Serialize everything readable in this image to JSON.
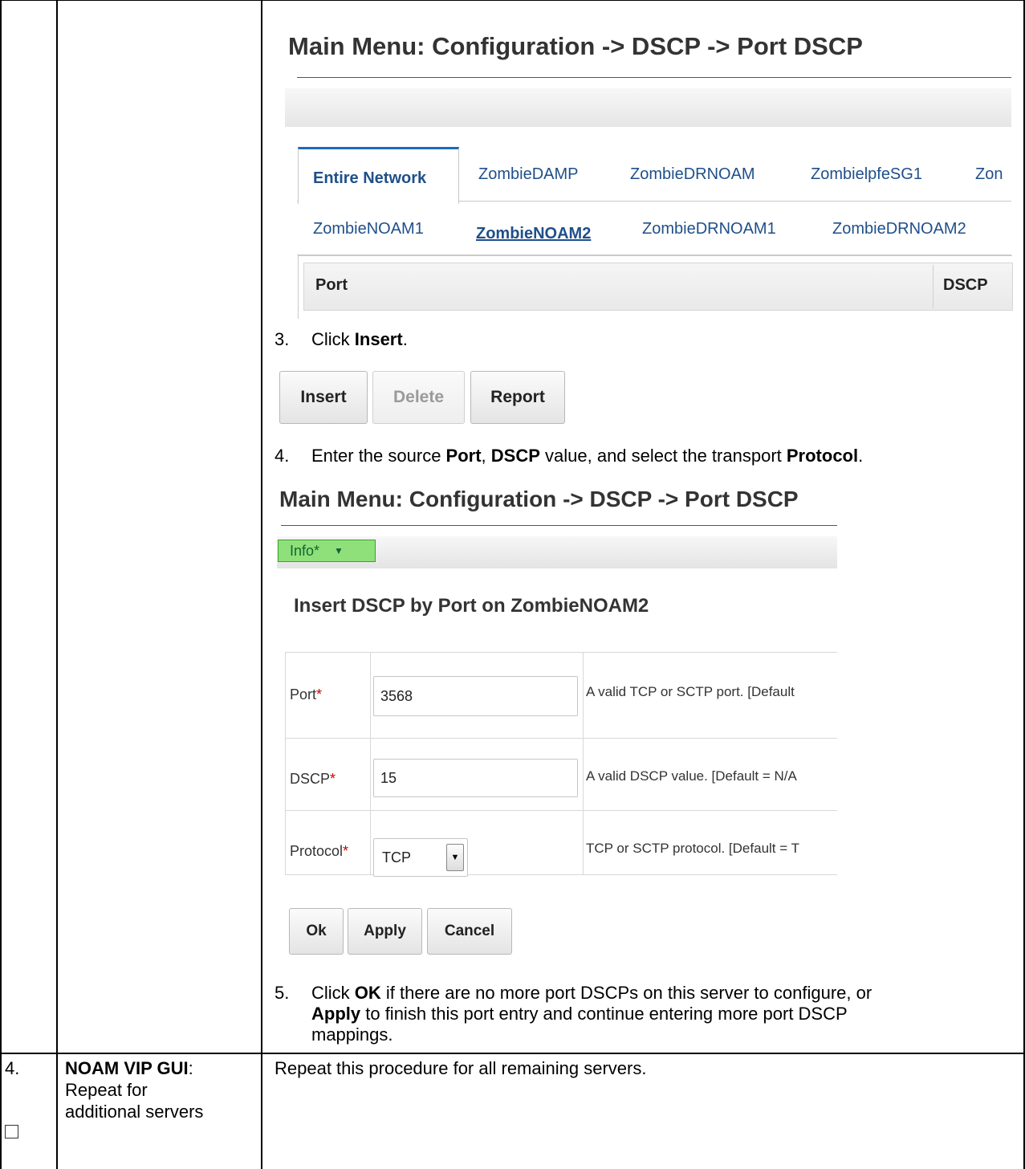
{
  "shot1": {
    "title": "Main Menu: Configuration -> DSCP -> Port DSCP",
    "tabs_row1": [
      "Entire Network",
      "ZombieDAMP",
      "ZombieDRNOAM",
      "ZombielpfeSG1",
      "Zon"
    ],
    "tabs_row2": [
      "ZombieNOAM1",
      "ZombieNOAM2",
      "ZombieDRNOAM1",
      "ZombieDRNOAM2"
    ],
    "columns": [
      "Port",
      "DSCP"
    ]
  },
  "step3": {
    "num": "3.",
    "pre": "Click ",
    "bold": "Insert",
    "post": "."
  },
  "actions": {
    "insert": "Insert",
    "delete": "Delete",
    "report": "Report"
  },
  "step4": {
    "num": "4.",
    "t1": "Enter the source ",
    "b1": "Port",
    "t2": ", ",
    "b2": "DSCP",
    "t3": " value, and select the transport ",
    "b3": "Protocol",
    "t4": "."
  },
  "shot2": {
    "title": "Main Menu: Configuration -> DSCP -> Port DSCP",
    "info_label": "Info*",
    "form_title": "Insert DSCP by Port on ZombieNOAM2",
    "fields": [
      {
        "label": "Port",
        "value": "3568",
        "help": "A valid TCP or SCTP port. [Default"
      },
      {
        "label": "DSCP",
        "value": "15",
        "help": "A valid DSCP value. [Default = N/A"
      },
      {
        "label": "Protocol",
        "value": "TCP",
        "help": "TCP or SCTP protocol. [Default = T"
      }
    ],
    "required_mark": "*",
    "buttons": {
      "ok": "Ok",
      "apply": "Apply",
      "cancel": "Cancel"
    }
  },
  "step5": {
    "num": "5.",
    "t1": "Click ",
    "b1": "OK",
    "t2": " if there are no more port DSCPs on this server to configure, or",
    "b2": "Apply",
    "t3": " to finish this port entry and continue entering more port DSCP",
    "t4": "mappings."
  },
  "row4": {
    "step": "4.",
    "title_bold": "NOAM VIP GUI",
    "title_after": ":",
    "line2": "Repeat for",
    "line3": "additional servers",
    "body": "Repeat this procedure for all remaining servers."
  }
}
